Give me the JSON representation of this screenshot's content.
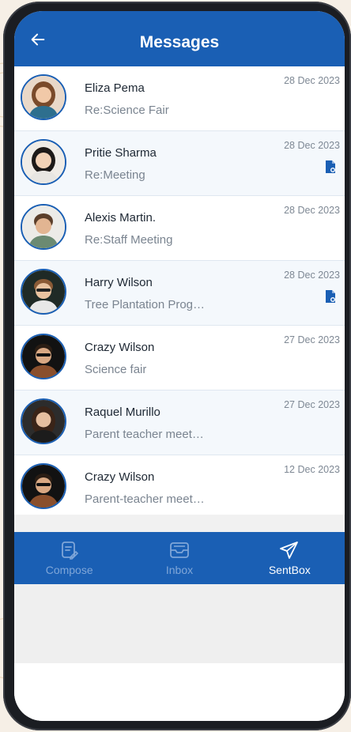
{
  "header": {
    "title": "Messages",
    "back_icon": "arrow-left-icon"
  },
  "colors": {
    "primary": "#1a5fb4",
    "row_alt": "#f4f8fc",
    "tab_inactive": "#7fa6d8"
  },
  "messages": [
    {
      "name": "Eliza Pema",
      "subject": "Re:Science Fair",
      "date": "28 Dec 2023",
      "attachment": false
    },
    {
      "name": "Pritie Sharma",
      "subject": "Re:Meeting",
      "date": "28 Dec 2023",
      "attachment": true
    },
    {
      "name": "Alexis Martin.",
      "subject": "Re:Staff Meeting",
      "date": "28 Dec 2023",
      "attachment": false
    },
    {
      "name": "Harry Wilson",
      "subject": "Tree Plantation Prog…",
      "date": "28 Dec 2023",
      "attachment": true
    },
    {
      "name": "Crazy Wilson",
      "subject": "Science fair",
      "date": "27 Dec 2023",
      "attachment": false
    },
    {
      "name": "Raquel Murillo",
      "subject": "Parent teacher meet…",
      "date": "27 Dec 2023",
      "attachment": false
    },
    {
      "name": "Crazy Wilson",
      "subject": "Parent-teacher meet…",
      "date": "12 Dec 2023",
      "attachment": false
    }
  ],
  "tabs": [
    {
      "label": "Compose",
      "icon": "compose-icon",
      "active": false
    },
    {
      "label": "Inbox",
      "icon": "inbox-icon",
      "active": false
    },
    {
      "label": "SentBox",
      "icon": "send-icon",
      "active": true
    }
  ]
}
